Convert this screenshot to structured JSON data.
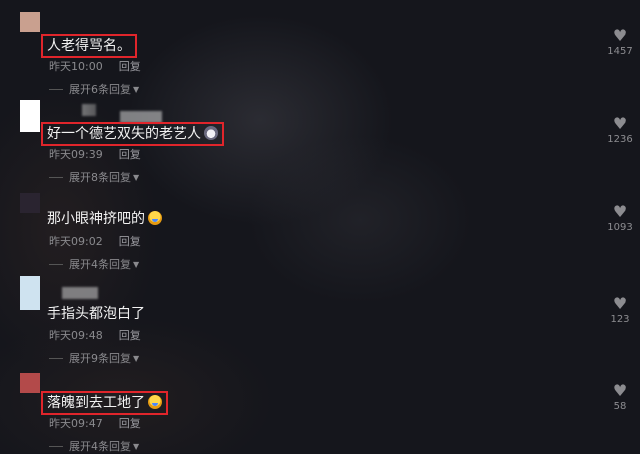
{
  "comments": [
    {
      "text": "人老得骂名。",
      "time": "昨天10:00",
      "reply": "回复",
      "expand": "展开6条回复",
      "likes": "1457",
      "emoji": "",
      "avatar_color": "#c9a08f"
    },
    {
      "text": "好一个德艺双失的老艺人",
      "time": "昨天09:39",
      "reply": "回复",
      "expand": "展开8条回复",
      "likes": "1236",
      "emoji": "cat-emoji",
      "avatar_color": "#ffffff"
    },
    {
      "text": "那小眼神挤吧的",
      "time": "昨天09:02",
      "reply": "回复",
      "expand": "展开4条回复",
      "likes": "1093",
      "emoji": "laughing-emoji",
      "avatar_color": "#2a2430"
    },
    {
      "text": "手指头都泡白了",
      "time": "昨天09:48",
      "reply": "回复",
      "expand": "展开9条回复",
      "likes": "123",
      "emoji": "",
      "avatar_color": "#cfe3f0"
    },
    {
      "text": "落魄到去工地了",
      "time": "昨天09:47",
      "reply": "回复",
      "expand": "展开4条回复",
      "likes": "58",
      "emoji": "laughing-emoji",
      "avatar_color": "#b34a4a"
    }
  ],
  "colors": {
    "highlight_box": "#e0252b",
    "background": "#15161c"
  }
}
